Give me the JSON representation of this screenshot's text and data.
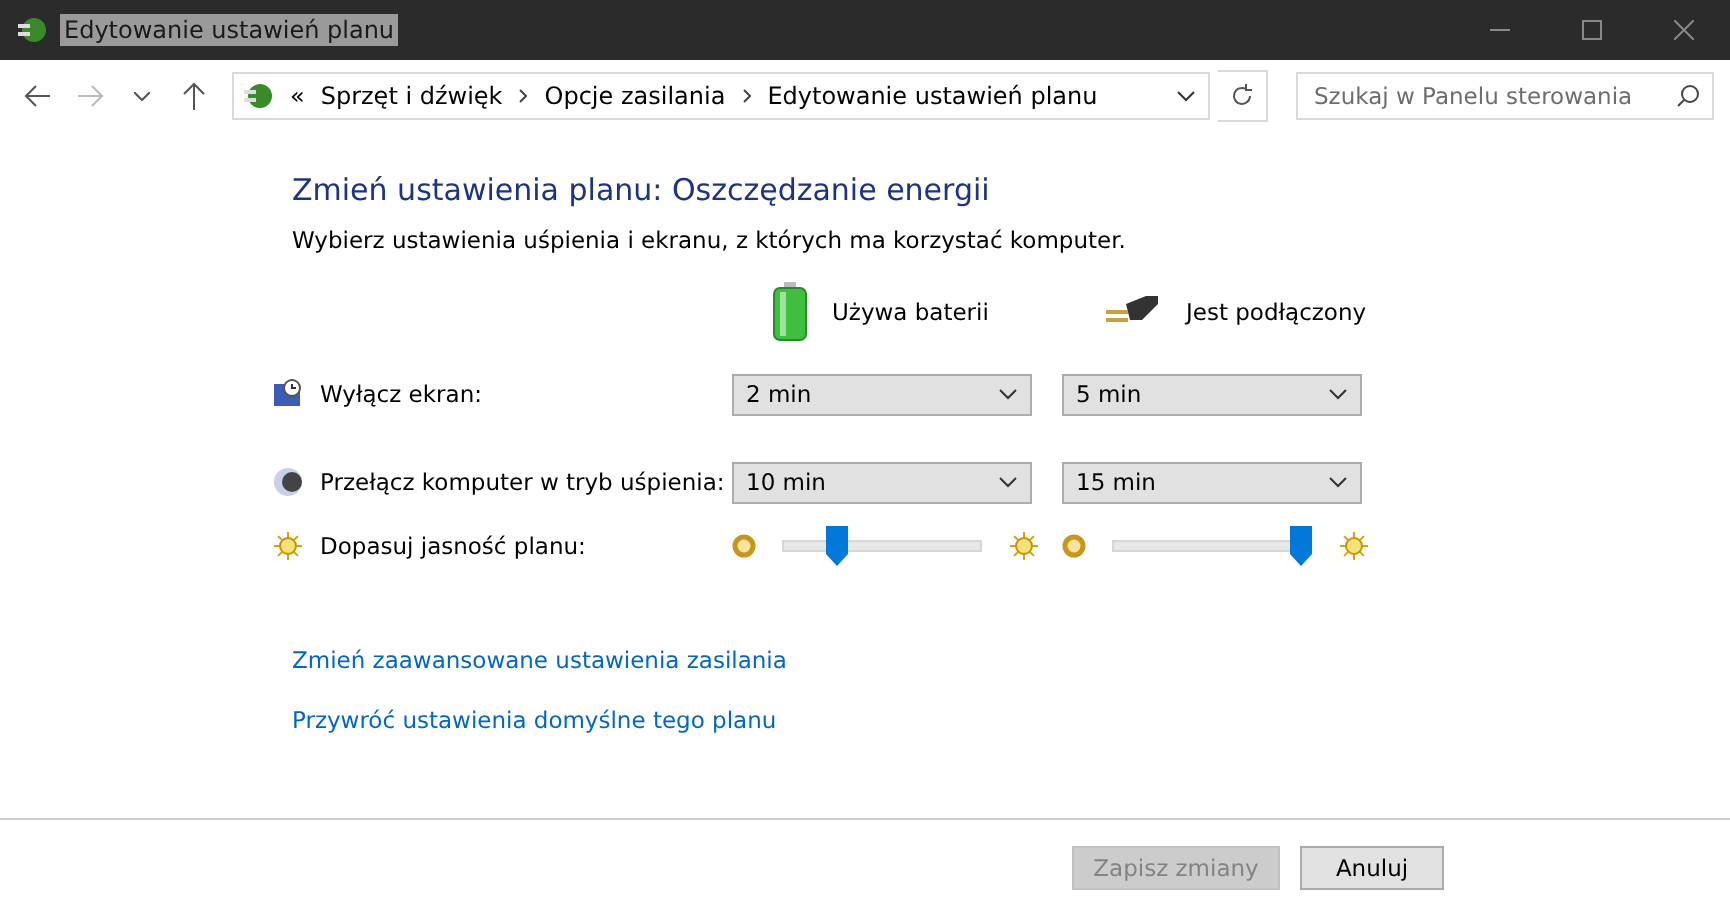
{
  "window": {
    "title": "Edytowanie ustawień planu",
    "title_selected": true
  },
  "address_bar": {
    "overflow": "«",
    "breadcrumbs": [
      "Sprzęt i dźwięk",
      "Opcje zasilania",
      "Edytowanie ustawień planu"
    ]
  },
  "search": {
    "placeholder": "Szukaj w Panelu sterowania"
  },
  "heading": "Zmień ustawienia planu: Oszczędzanie energii",
  "subheading": "Wybierz ustawienia uśpienia i ekranu, z których ma korzystać komputer.",
  "columns": [
    {
      "label": "Używa baterii",
      "kind": "battery"
    },
    {
      "label": "Jest podłączony",
      "kind": "plug"
    }
  ],
  "settings": [
    {
      "label": "Wyłącz ekran:",
      "kind": "dropdown",
      "values": [
        "2 min",
        "5 min"
      ]
    },
    {
      "label": "Przełącz komputer w tryb uśpienia:",
      "kind": "dropdown",
      "values": [
        "10 min",
        "15 min"
      ]
    },
    {
      "label": "Dopasuj jasność planu:",
      "kind": "slider",
      "sliders": [
        {
          "level": 0.27
        },
        {
          "level": 0.95
        }
      ]
    }
  ],
  "links": [
    "Zmień zaawansowane ustawienia zasilania",
    "Przywróć ustawienia domyślne tego planu"
  ],
  "buttons": [
    {
      "label": "Zapisz zmiany",
      "disabled": true
    },
    {
      "label": "Anuluj",
      "disabled": false
    }
  ]
}
